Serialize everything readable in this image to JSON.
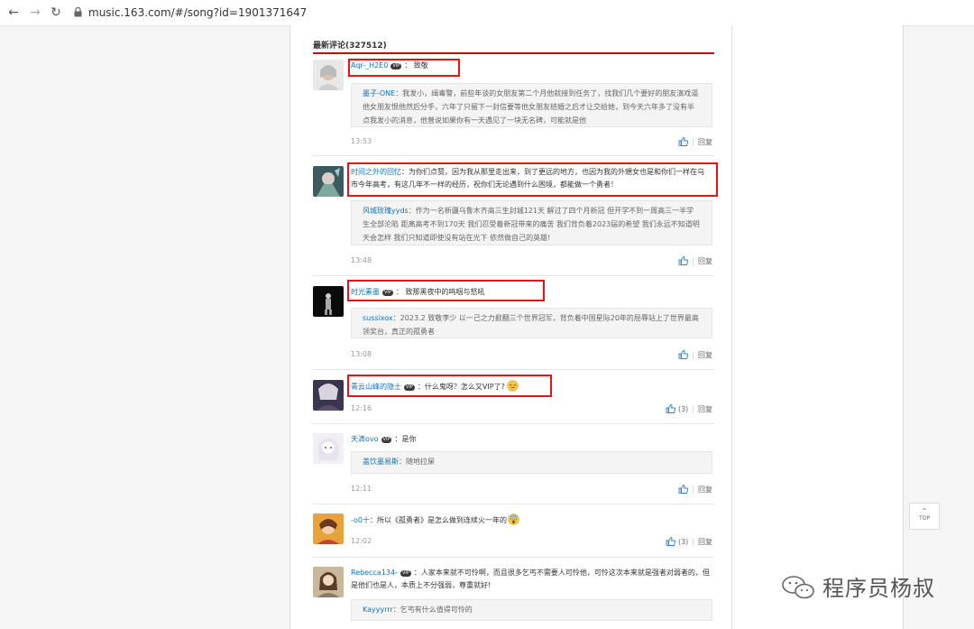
{
  "browser": {
    "url": "music.163.com/#/song?id=1901371647"
  },
  "section_title": "最新评论(327512)",
  "comments": [
    {
      "user": "Aqr-_H2E0",
      "vip": "VIP",
      "text": "：  致敬",
      "reply_user": "墨子-ONE",
      "reply_text": "：我发小，缉毒警，前些年谈的女朋友第二个月他就接到任务了，找我们几个要好的朋友演戏逼他女朋友恨他然后分手，六年了只留下一封信要等他女朋友结婚之后才让交给她，到今天六年多了没有半点我发小的消息，他曾说如果你有一天遇见了一块无名碑，可能就是他",
      "time": "13:53",
      "reply_label": "回复"
    },
    {
      "user": "时间之外的回忆",
      "vip": "",
      "text": "：为你们点赞，因为我从那里走出来，到了更远的地方，也因为我的外甥女也是和你们一样在乌市今年高考，有这几年不一样的经历，祝你们无论遇到什么困境，都能做一个勇者！",
      "reply_user": "风城玫瑰yyds",
      "reply_text": "：作为一名新疆乌鲁木齐高三生封城121天 解过了四个月新冠 但开学不到一周高三一半学生全部沦陷 距离高考不到170天 我们忍受着新冠带来的痛苦 我们背负着2023届的希望 我们永远不知道明天会怎样 我们只知道即使没有站在光下 依然做自己的英雄!",
      "time": "13:48",
      "reply_label": "回复"
    },
    {
      "user": "时光素墨",
      "vip": "VIP",
      "text": "：  致那黑夜中的鸣咽与怒吼",
      "reply_user": "sussixox",
      "reply_text": "：2023.2 致敬李少 以一己之力掀翻三个世界冠军，背负着中国星际20年的屈辱站上了世界最高领奖台，真正的孤勇者",
      "time": "13:08",
      "reply_label": "回复"
    },
    {
      "user": "青云山峰的隐士",
      "vip": "VIP",
      "text": "：什么鬼呀？怎么又VIP了?",
      "time": "12:16",
      "likes": "(3)",
      "reply_label": "回复"
    },
    {
      "user": "天滴ovo",
      "vip": "VIP",
      "text": "：是你",
      "reply_user": "盖饮墨易斯",
      "reply_text": "：随地拉屎",
      "time": "12:11",
      "reply_label": "回复"
    },
    {
      "user": "-o0十",
      "vip": "",
      "text": "：所以《孤勇者》是怎么做到连续火一年的",
      "time": "12:02",
      "likes": "(3)",
      "reply_label": "回复"
    },
    {
      "user": "Rebecca134-",
      "vip": "VIP",
      "text": "：人家本来就不可怜啊，而且很多乞丐不需要人可怜他，可怜这次本来就是强者对弱者的，但是他们也是人，本质上不分强弱，尊重就好!",
      "reply_user": "Kayyyrrr",
      "reply_text": "：乞丐有什么值得可怜的"
    }
  ],
  "top_button": "TOP",
  "watermark": "程序员杨叔"
}
